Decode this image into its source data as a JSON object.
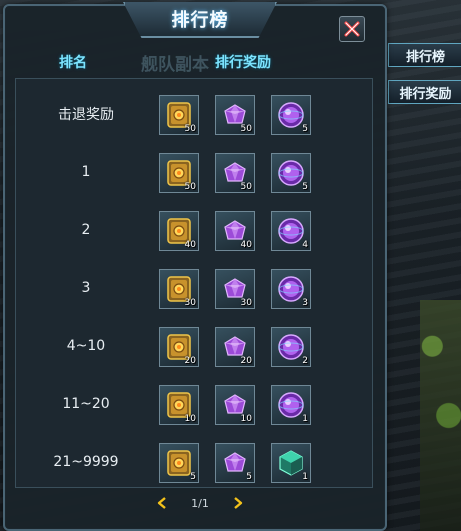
{
  "panel": {
    "title": "排行榜",
    "header_rank": "排名",
    "header_watermark": "舰队副本",
    "header_reward": "排行奖励"
  },
  "side_tabs": [
    "排行榜",
    "排行奖励"
  ],
  "rows": [
    {
      "rank": "击退奖励",
      "counts": [
        "50",
        "50",
        "5"
      ]
    },
    {
      "rank": "1",
      "counts": [
        "50",
        "50",
        "5"
      ]
    },
    {
      "rank": "2",
      "counts": [
        "40",
        "40",
        "4"
      ]
    },
    {
      "rank": "3",
      "counts": [
        "30",
        "30",
        "3"
      ]
    },
    {
      "rank": "4~10",
      "counts": [
        "20",
        "20",
        "2"
      ]
    },
    {
      "rank": "11~20",
      "counts": [
        "10",
        "10",
        "1"
      ]
    },
    {
      "rank": "21~9999",
      "counts": [
        "5",
        "5",
        "1"
      ]
    }
  ],
  "pager": {
    "page": "1/1"
  },
  "icons": {
    "item1": "gold-crate-icon",
    "item2": "purple-crystal-icon",
    "item3": "purple-orb-icon",
    "item3_last": "green-cube-icon"
  },
  "colors": {
    "title_glow": "#5fc2ff",
    "header_cyan": "#7ce4ff",
    "arrow_gold": "#f3c21b"
  }
}
